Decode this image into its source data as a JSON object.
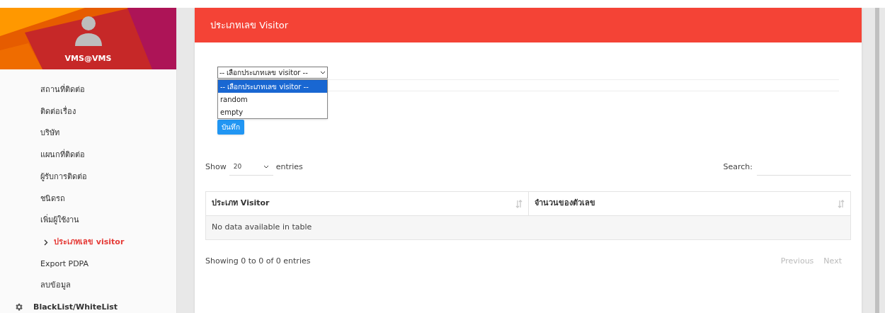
{
  "sidebar": {
    "user": "VMS@VMS",
    "items": [
      {
        "label": "สถานที่ติดต่อ",
        "selected": false
      },
      {
        "label": "ติดต่อเรื่อง",
        "selected": false
      },
      {
        "label": "บริษัท",
        "selected": false
      },
      {
        "label": "แผนกที่ติดต่อ",
        "selected": false
      },
      {
        "label": "ผู้รับการติดต่อ",
        "selected": false
      },
      {
        "label": "ชนิดรถ",
        "selected": false
      },
      {
        "label": "เพิ่มผู้ใช้งาน",
        "selected": false
      },
      {
        "label": "ประเภทเลข visitor",
        "selected": true
      },
      {
        "label": "Export PDPA",
        "selected": false
      },
      {
        "label": "ลบข้อมูล",
        "selected": false
      }
    ],
    "section": "BlackList/WhiteList"
  },
  "card": {
    "title": "ประเภทเลข Visitor",
    "select": {
      "value": "-- เลือกประเภทเลข visitor --",
      "expanded": true,
      "options": [
        {
          "label": "-- เลือกประเภทเลข visitor --",
          "selected": true
        },
        {
          "label": "random",
          "selected": false
        },
        {
          "label": "empty",
          "selected": false
        }
      ]
    },
    "save_button": "บันทึก",
    "table": {
      "show_label": "Show",
      "length": "20",
      "entries_label": "entries",
      "search_label": "Search:",
      "columns": [
        "ประเภท Visitor",
        "จำนวนของตัวเลข"
      ],
      "empty": "No data available in table",
      "info": "Showing 0 to 0 of 0 entries",
      "pagination": [
        {
          "label": "Previous",
          "disabled": true
        },
        {
          "label": "Next",
          "disabled": true
        }
      ]
    }
  }
}
